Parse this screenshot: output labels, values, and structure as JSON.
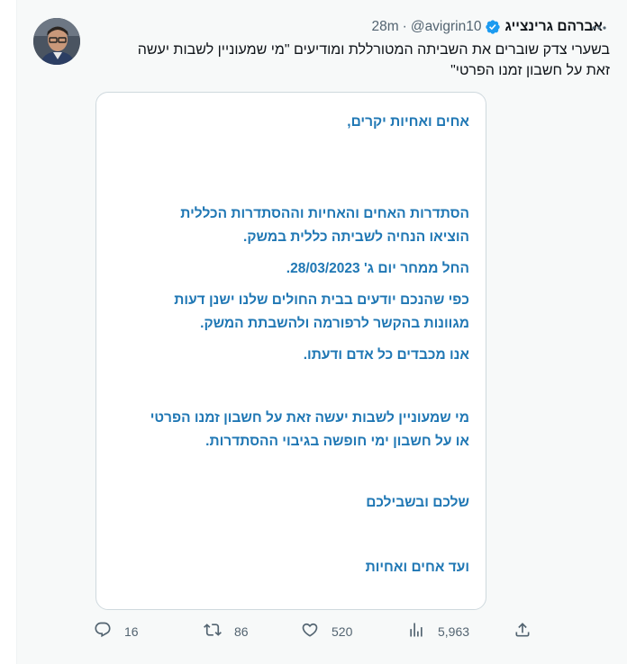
{
  "tweet": {
    "display_name": "אברהם גרינצייג",
    "handle": "@avigrin10",
    "separator": "·",
    "time": "28m",
    "text_line1": "בשערי צדק שוברים את השביתה המטורללת ומודיעים \"מי שמעוניין לשבות יעשה",
    "text_line2": "זאת על חשבון זמנו הפרטי\""
  },
  "card": {
    "p1": "אחים ואחיות יקרים,",
    "p2_line1": "הסתדרות האחים והאחיות וההסתדרות הכללית",
    "p2_line2": "הוציאו הנחיה לשביתה כללית במשק.",
    "p3": "החל ממחר יום ג' 28/03/2023.",
    "p4_line1": "כפי שהנכם יודעים בבית החולים שלנו ישנן דעות",
    "p4_line2": "מגוונות בהקשר לרפורמה ולהשבתת המשק.",
    "p5": "אנו מכבדים כל אדם ודעתו.",
    "p6_line1": "מי שמעוניין לשבות יעשה זאת על חשבון זמנו הפרטי",
    "p6_line2": "או על חשבון ימי חופשה בגיבוי ההסתדרות.",
    "p7": "שלכם ובשבילכם",
    "p8": "ועד אחים ואחיות"
  },
  "actions": {
    "replies": "16",
    "retweets": "86",
    "likes": "520",
    "views": "5,963"
  },
  "colors": {
    "accent": "#1d9bf0",
    "card_text": "#1f77b4",
    "muted": "#536471"
  }
}
